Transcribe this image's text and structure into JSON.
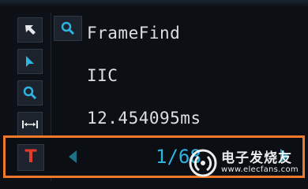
{
  "colors": {
    "background": "#0c0f14",
    "text": "#dcdfe4",
    "accent": "#2fb4e2",
    "highlight_border": "#f0782a",
    "trigger_red": "#e33b2b"
  },
  "toolbar": {
    "tools": [
      {
        "icon": "pointer-arrow-icon"
      },
      {
        "icon": "cursor-arrow-icon"
      },
      {
        "icon": "zoom-icon"
      },
      {
        "icon": "measure-width-icon"
      },
      {
        "icon": "trigger-text-icon",
        "label": "T"
      }
    ]
  },
  "search": {
    "icon": "search-icon"
  },
  "info": {
    "title": "FrameFind",
    "protocol": "IIC",
    "time": "12.454095ms"
  },
  "navigation": {
    "page": "1/68",
    "prev_icon": "triangle-left-icon",
    "next_icon": "triangle-right-icon"
  },
  "watermark": {
    "cn": "电子发烧友",
    "en": "www.elecfans.com"
  }
}
